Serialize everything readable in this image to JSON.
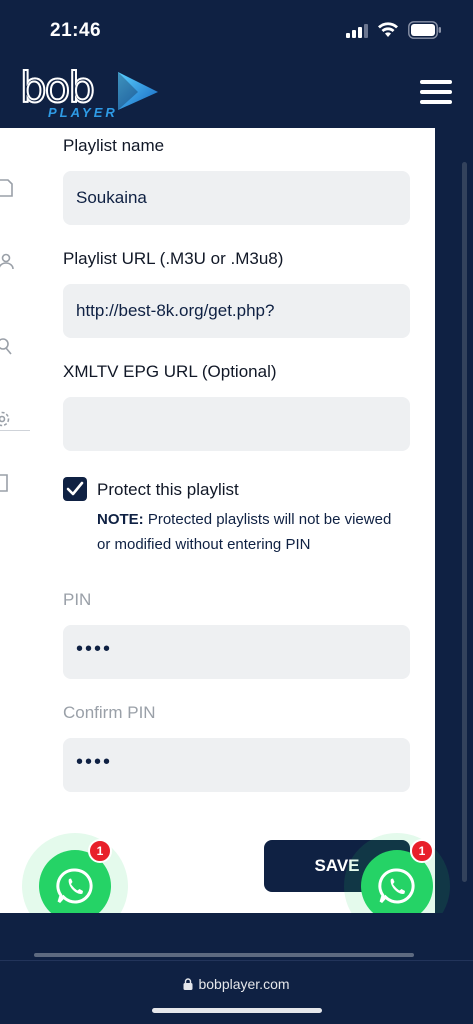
{
  "status_bar": {
    "time": "21:46",
    "icons": [
      "signal-icon",
      "wifi-icon",
      "battery-icon"
    ]
  },
  "header": {
    "logo_word": "bob",
    "logo_sub": "PLAYER",
    "menu_icon": "hamburger-menu-icon"
  },
  "side_icons": [
    "file-icon",
    "user-icon",
    "search-user-icon",
    "gear-icon",
    "logout-icon"
  ],
  "form": {
    "playlist_name_label": "Playlist name",
    "playlist_name_value": "Soukaina",
    "playlist_url_label": "Playlist URL (.M3U or .M3u8)",
    "playlist_url_value": "http://best-8k.org/get.php?",
    "epg_url_label": "XMLTV EPG URL (Optional)",
    "epg_url_value": "",
    "protect_checked": true,
    "protect_label": "Protect this playlist",
    "note_prefix": "NOTE:",
    "note_text": "Protected playlists will not be viewed or modified without entering PIN",
    "pin_label": "PIN",
    "pin_value": "••••",
    "confirm_pin_label": "Confirm PIN",
    "confirm_pin_value": "••••",
    "save_label": "SAVE"
  },
  "whatsapp": {
    "left_badge": "1",
    "right_badge": "1"
  },
  "browser": {
    "url": "bobplayer.com"
  },
  "colors": {
    "navy": "#0f2143",
    "whatsapp_green": "#25d366",
    "badge_red": "#e8202a",
    "logo_blue": "#2e9be6"
  }
}
